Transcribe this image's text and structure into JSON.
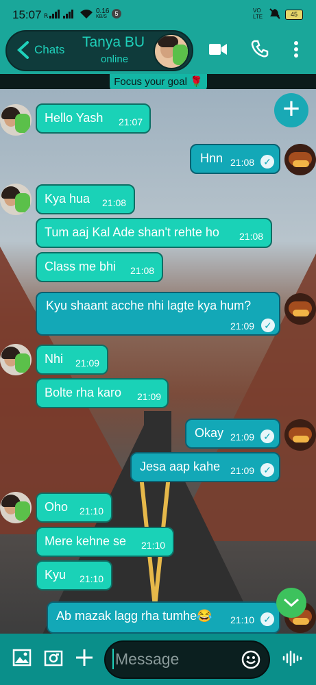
{
  "status_bar": {
    "time": "15:07",
    "speed": "0.16",
    "speed_unit": "KB/S",
    "notif_count": "5",
    "volte": "VO LTE",
    "battery": "45"
  },
  "header": {
    "back_label": "Chats",
    "contact_name": "Tanya BU",
    "status": "online"
  },
  "banner": {
    "text": "Focus your goal 🌹"
  },
  "messages": [
    {
      "dir": "in",
      "text": "Hello Yash",
      "time": "21:07"
    },
    {
      "dir": "out",
      "text": "Hnn",
      "time": "21:08"
    },
    {
      "dir": "in",
      "text": "Kya hua",
      "time": "21:08"
    },
    {
      "dir": "in",
      "text": "Tum aaj Kal Ade shan't rehte ho",
      "time": "21:08"
    },
    {
      "dir": "in",
      "text": "Class me bhi",
      "time": "21:08"
    },
    {
      "dir": "out",
      "text": "Kyu shaant acche nhi lagte kya hum?",
      "time": "21:09"
    },
    {
      "dir": "in",
      "text": "Nhi",
      "time": "21:09"
    },
    {
      "dir": "in",
      "text": "Bolte rha karo",
      "time": "21:09"
    },
    {
      "dir": "out",
      "text": "Okay",
      "time": "21:09"
    },
    {
      "dir": "out",
      "text": "Jesa aap kahe",
      "time": "21:09"
    },
    {
      "dir": "in",
      "text": "Oho",
      "time": "21:10"
    },
    {
      "dir": "in",
      "text": "Mere kehne se",
      "time": "21:10"
    },
    {
      "dir": "in",
      "text": "Kyu",
      "time": "21:10"
    },
    {
      "dir": "out",
      "text": "Ab mazak lagg rha tumhe😂",
      "time": "21:10"
    }
  ],
  "composer": {
    "placeholder": "Message"
  },
  "colors": {
    "incoming": "#1ad2b7",
    "outgoing": "#13a8b7",
    "header": "#1aa79a",
    "accent": "#1fd1bb"
  },
  "icons": [
    "back-icon",
    "video-call-icon",
    "phone-icon",
    "more-icon",
    "add-icon",
    "gallery-icon",
    "camera-icon",
    "plus-icon",
    "emoji-icon",
    "voice-icon",
    "scroll-down-icon",
    "read-check-icon"
  ]
}
